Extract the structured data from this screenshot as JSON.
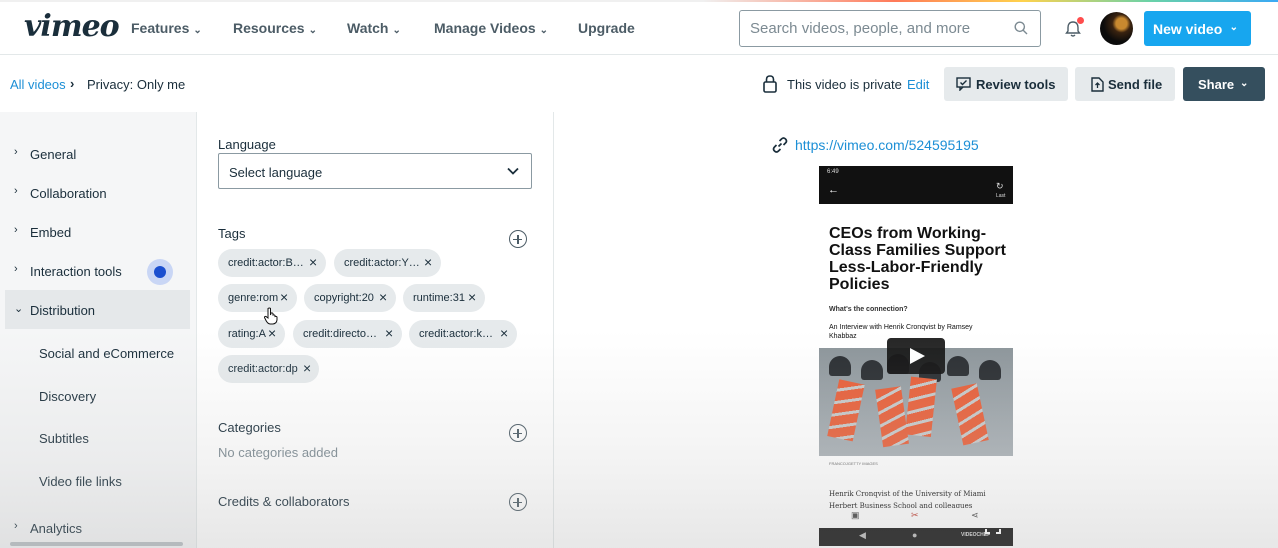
{
  "header": {
    "logo": "vimeo",
    "nav": [
      {
        "label": "Features",
        "has_dropdown": true
      },
      {
        "label": "Resources",
        "has_dropdown": true
      },
      {
        "label": "Watch",
        "has_dropdown": true
      },
      {
        "label": "Manage Videos",
        "has_dropdown": true
      },
      {
        "label": "Upgrade",
        "has_dropdown": false
      }
    ],
    "search_placeholder": "Search videos, people, and more",
    "new_video_label": "New video",
    "notification_dot_color": "#ff4d4d"
  },
  "breadcrumb": {
    "root": "All videos",
    "separator": "›",
    "current": "Privacy: Only me"
  },
  "privacy": {
    "status_text": "This video is private",
    "edit_label": "Edit"
  },
  "actions": {
    "review_tools": "Review tools",
    "send_file": "Send file",
    "share": "Share"
  },
  "sidebar": {
    "items": [
      {
        "label": "General",
        "expanded": false
      },
      {
        "label": "Collaboration",
        "expanded": false
      },
      {
        "label": "Embed",
        "expanded": false
      },
      {
        "label": "Interaction tools",
        "expanded": false
      },
      {
        "label": "Distribution",
        "expanded": true
      }
    ],
    "subitems": [
      "Social and eCommerce",
      "Discovery",
      "Subtitles",
      "Video file links"
    ],
    "cut_off_item": "Analytics"
  },
  "form": {
    "language_label": "Language",
    "language_value": "Select language",
    "tags_label": "Tags",
    "tags": [
      "credit:actor:B…",
      "credit:actor:Y…",
      "genre:rom",
      "copyright:20",
      "runtime:31",
      "rating:A",
      "credit:directo…",
      "credit:actor:k…",
      "credit:actor:dp"
    ],
    "categories_label": "Categories",
    "categories_empty": "No categories added",
    "credits_label": "Credits & collaborators"
  },
  "preview": {
    "url": "https://vimeo.com/524595195",
    "status_time": "6:49",
    "last_label": "Last",
    "headline": "CEOs from Working-Class Families Support Less-Labor-Friendly Policies",
    "dek": "What's the connection?",
    "byline": "An Interview with Henrik Cronqvist by Ramsey Khabbaz",
    "photo_credit": "FRANCOJGETTY IMAGES",
    "body": "Henrik Cronqvist of the University of Miami Herbert Business School and colleagues",
    "watermark": "VIDEOCHEF"
  },
  "colors": {
    "accent": "#17a6ef",
    "link": "#1c8fd6",
    "share_bg": "#354f5e",
    "interaction_dot": "#1b4fcf"
  }
}
